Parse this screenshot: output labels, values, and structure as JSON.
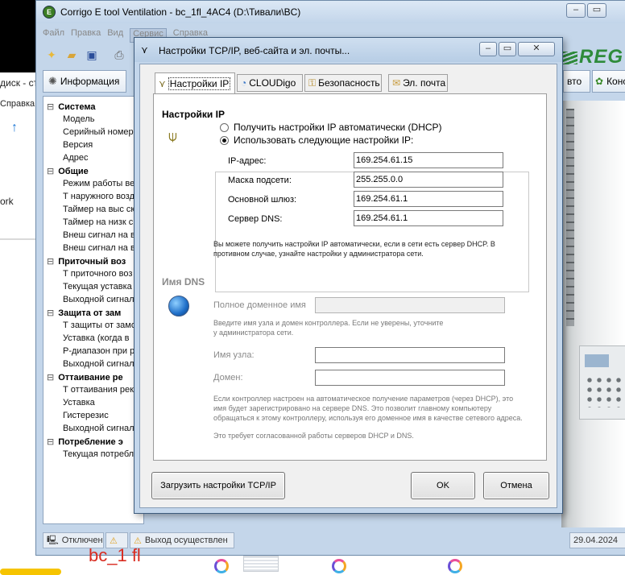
{
  "bg_left": {
    "rows": [
      "диск - сто",
      "Справка",
      "ork"
    ]
  },
  "app": {
    "title": "Corrigo E tool Ventilation - bc_1fl_4AC4 (D:\\Тивали\\BC)",
    "menu": [
      "Файл",
      "Правка",
      "Вид",
      "Сервис",
      "Справка"
    ],
    "active_menu_index": 3,
    "brand": "REG",
    "tabs": [
      {
        "label": "Информация",
        "icon": "gear-icon"
      },
      {
        "label": "вто",
        "icon": "none"
      },
      {
        "label": "Конс",
        "icon": "plant-icon"
      }
    ],
    "tree": [
      {
        "type": "group",
        "label": "Система"
      },
      {
        "type": "item",
        "label": "Модель"
      },
      {
        "type": "item",
        "label": "Серийный номер"
      },
      {
        "type": "item",
        "label": "Версия"
      },
      {
        "type": "item",
        "label": "Адрес"
      },
      {
        "type": "group",
        "label": "Общие"
      },
      {
        "type": "item",
        "label": "Режим работы ве"
      },
      {
        "type": "item",
        "label": "Т наружного возд"
      },
      {
        "type": "item",
        "label": "Таймер на выс ск"
      },
      {
        "type": "item",
        "label": "Таймер на низк с"
      },
      {
        "type": "item",
        "label": "Внеш сигнал на в"
      },
      {
        "type": "item",
        "label": "Внеш сигнал на в"
      },
      {
        "type": "group",
        "label": "Приточный воз"
      },
      {
        "type": "item",
        "label": "Т приточного воз"
      },
      {
        "type": "item",
        "label": "Текущая уставка"
      },
      {
        "type": "item",
        "label": "Выходной сигнал"
      },
      {
        "type": "group",
        "label": "Защита от зам"
      },
      {
        "type": "item",
        "label": "Т защиты от замо"
      },
      {
        "type": "item",
        "label": "Уставка (когда в"
      },
      {
        "type": "item",
        "label": "Р-диапазон при р"
      },
      {
        "type": "item",
        "label": "Выходной сигнал"
      },
      {
        "type": "group",
        "label": "Оттаивание ре"
      },
      {
        "type": "item",
        "label": "Т оттаивания рек"
      },
      {
        "type": "item",
        "label": "Уставка"
      },
      {
        "type": "item",
        "label": "Гистерезис"
      },
      {
        "type": "item",
        "label": "Выходной сигнал"
      },
      {
        "type": "group",
        "label": "Потребление э"
      },
      {
        "type": "item",
        "label": "Текущая потребл"
      }
    ],
    "status": {
      "connection": "Отключен",
      "exit": "Выход осуществлен",
      "date": "29.04.2024"
    }
  },
  "dialog": {
    "title": "Настройки TCP/IP, веб-сайта и эл. почты...",
    "tabs": [
      {
        "label": "Настройки IP",
        "icon": "network-icon",
        "selected": true
      },
      {
        "label": "CLOUDigo",
        "icon": "cloud-icon",
        "selected": false
      },
      {
        "label": "Безопасность",
        "icon": "lock-icon",
        "selected": false
      },
      {
        "label": "Эл. почта",
        "icon": "envelope-icon",
        "selected": false
      }
    ],
    "ip_section": {
      "heading": "Настройки IP",
      "radio_dhcp": "Получить настройки IP автоматически (DHCP)",
      "radio_manual": "Использовать следующие настройки IP:",
      "selected": "manual",
      "fields": [
        {
          "label": "IP-адрес:",
          "value": "169.254.61.15"
        },
        {
          "label": "Маска подсети:",
          "value": "255.255.0.0"
        },
        {
          "label": "Основной шлюз:",
          "value": "169.254.61.1"
        },
        {
          "label": "Сервер DNS:",
          "value": "169.254.61.1"
        }
      ],
      "note": "Вы можете получить настройки IP автоматически, если в сети есть сервер DHCP. В противном случае, узнайте настройки у администратора сети."
    },
    "dns_section": {
      "heading": "Имя DNS",
      "fqdn_label": "Полное доменное имя",
      "fqdn_value": "",
      "hint": "Введите имя узла и домен контроллера. Если не уверены, уточните у администратора сети.",
      "host_label": "Имя узла:",
      "host_value": "",
      "domain_label": "Домен:",
      "domain_value": "",
      "note1": "Если контроллер настроен на автоматическое получение параметров (через DHCP), это имя будет зарегистрировано на сервере DNS. Это позволит главному компьютеру обращаться к этому контроллеру, используя его доменное имя в качестве сетевого адреса.",
      "note2": "Это требует согласованной работы серверов DHCP и DNS."
    },
    "buttons": {
      "load": "Загрузить настройки TCP/IP",
      "ok": "OK",
      "cancel": "Отмена"
    }
  },
  "taskbar": {
    "label": "bc_1 fl"
  }
}
